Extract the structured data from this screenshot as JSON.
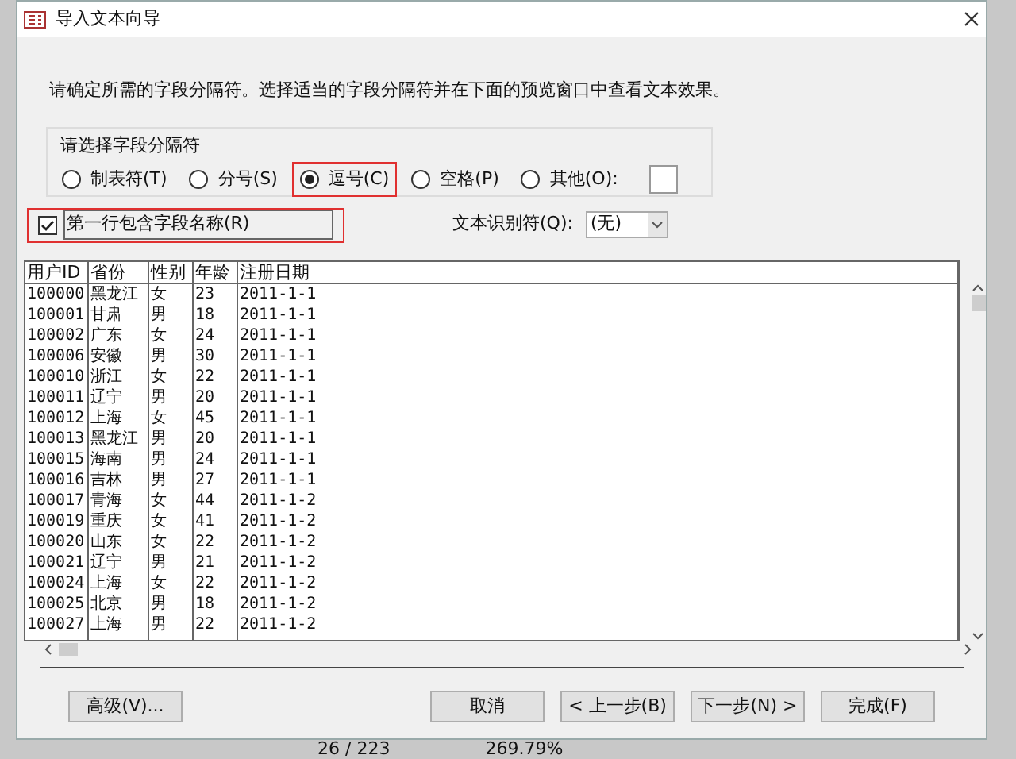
{
  "window": {
    "title": "导入文本向导"
  },
  "instruction": "请确定所需的字段分隔符。选择适当的字段分隔符并在下面的预览窗口中查看文本效果。",
  "delimiter_group": {
    "label": "请选择字段分隔符",
    "options": [
      {
        "label": "制表符(T)",
        "selected": false,
        "kind": "plain",
        "annotated": false
      },
      {
        "label": "分号(S)",
        "selected": false,
        "kind": "plain",
        "annotated": false
      },
      {
        "label": "逗号(C)",
        "selected": true,
        "kind": "plain",
        "annotated": true
      },
      {
        "label": "空格(P)",
        "selected": false,
        "kind": "plain",
        "annotated": false
      },
      {
        "label": "其他(O):",
        "selected": false,
        "kind": "with-field",
        "annotated": false
      }
    ]
  },
  "first_row_names": {
    "label": "第一行包含字段名称(R)",
    "checked": true,
    "annotated": true
  },
  "text_qualifier": {
    "label": "文本识别符(Q):",
    "value": "(无)"
  },
  "preview": {
    "columns": [
      "用户ID",
      "省份",
      "性别",
      "年龄",
      "注册日期"
    ],
    "rows": [
      [
        "100000",
        "黑龙江",
        "女",
        "23",
        "2011-1-1"
      ],
      [
        "100001",
        "甘肃",
        "男",
        "18",
        "2011-1-1"
      ],
      [
        "100002",
        "广东",
        "女",
        "24",
        "2011-1-1"
      ],
      [
        "100006",
        "安徽",
        "男",
        "30",
        "2011-1-1"
      ],
      [
        "100010",
        "浙江",
        "女",
        "22",
        "2011-1-1"
      ],
      [
        "100011",
        "辽宁",
        "男",
        "20",
        "2011-1-1"
      ],
      [
        "100012",
        "上海",
        "女",
        "45",
        "2011-1-1"
      ],
      [
        "100013",
        "黑龙江",
        "男",
        "20",
        "2011-1-1"
      ],
      [
        "100015",
        "海南",
        "男",
        "24",
        "2011-1-1"
      ],
      [
        "100016",
        "吉林",
        "男",
        "27",
        "2011-1-1"
      ],
      [
        "100017",
        "青海",
        "女",
        "44",
        "2011-1-2"
      ],
      [
        "100019",
        "重庆",
        "女",
        "41",
        "2011-1-2"
      ],
      [
        "100020",
        "山东",
        "女",
        "22",
        "2011-1-2"
      ],
      [
        "100021",
        "辽宁",
        "男",
        "21",
        "2011-1-2"
      ],
      [
        "100024",
        "上海",
        "女",
        "22",
        "2011-1-2"
      ],
      [
        "100025",
        "北京",
        "男",
        "18",
        "2011-1-2"
      ],
      [
        "100027",
        "上海",
        "男",
        "22",
        "2011-1-2"
      ]
    ]
  },
  "buttons": [
    {
      "label": "高级(V)...",
      "kind": "left"
    },
    {
      "label": "取消",
      "kind": "right"
    },
    {
      "label": "< 上一步(B)",
      "kind": "right"
    },
    {
      "label": "下一步(N) >",
      "kind": "right"
    },
    {
      "label": "完成(F)",
      "kind": "right"
    }
  ],
  "background_status": [
    "26 / 223",
    "269.79%"
  ]
}
